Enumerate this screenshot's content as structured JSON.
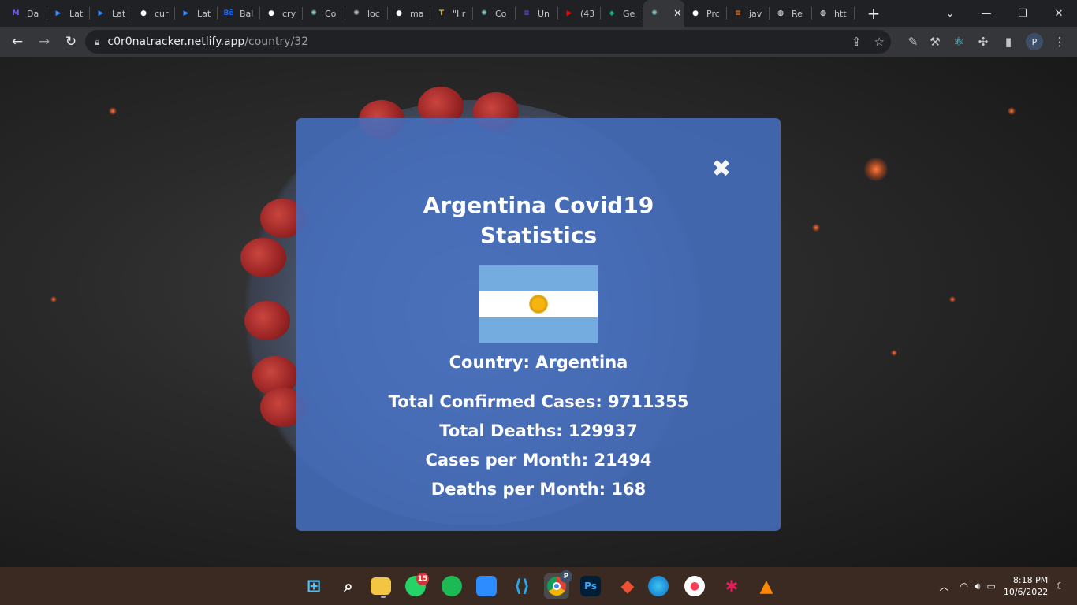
{
  "browser": {
    "tabs": [
      {
        "label": "Da",
        "icon": "m-logo-icon",
        "color": "#7b5cff"
      },
      {
        "label": "Lat",
        "icon": "zoom-icon",
        "color": "#2d8cff"
      },
      {
        "label": "Lat",
        "icon": "zoom-icon",
        "color": "#2d8cff"
      },
      {
        "label": "cur",
        "icon": "github-icon",
        "color": "#ffffff"
      },
      {
        "label": "Lat",
        "icon": "zoom-icon",
        "color": "#2d8cff"
      },
      {
        "label": "Bal",
        "icon": "behance-icon",
        "color": "#1769ff"
      },
      {
        "label": "cry",
        "icon": "github-icon",
        "color": "#ffffff"
      },
      {
        "label": "Co",
        "icon": "virus-icon",
        "color": "#7fc9c9"
      },
      {
        "label": "loc",
        "icon": "virus-icon",
        "color": "#bbbbbb"
      },
      {
        "label": "ma",
        "icon": "github-icon",
        "color": "#ffffff"
      },
      {
        "label": "\"I r",
        "icon": "t-logo-icon",
        "color": "#e8b53a"
      },
      {
        "label": "Co",
        "icon": "virus-icon",
        "color": "#7fc9c9"
      },
      {
        "label": "Un",
        "icon": "list-icon",
        "color": "#6b4fd8"
      },
      {
        "label": "(43",
        "icon": "youtube-icon",
        "color": "#ff0000"
      },
      {
        "label": "Ge",
        "icon": "diamond-icon",
        "color": "#10a37f"
      },
      {
        "label": "",
        "icon": "virus-icon",
        "color": "#7fc9c9",
        "active": true
      },
      {
        "label": "Prc",
        "icon": "github-icon",
        "color": "#ffffff"
      },
      {
        "label": "jav",
        "icon": "stackoverflow-icon",
        "color": "#f48024"
      },
      {
        "label": "Re",
        "icon": "globe-icon",
        "color": "#ffffff"
      },
      {
        "label": "htt",
        "icon": "globe-icon",
        "color": "#ffffff"
      }
    ],
    "tab_close": "✕",
    "new_tab": "+",
    "url_host": "c0r0natracker.netlify.app",
    "url_path": "/country/32",
    "profile_initial": "P"
  },
  "modal": {
    "title_line1": "Argentina Covid19",
    "title_line2": "Statistics",
    "close_symbol": "✖",
    "country_label": "Country: Argentina",
    "stats": [
      "Total Confirmed Cases: 9711355",
      "Total Deaths: 129937",
      "Cases per Month: 21494",
      "Deaths per Month: 168"
    ],
    "flag_colors": {
      "light_blue": "#74acdf",
      "white": "#ffffff",
      "sun": "#f6b40e"
    }
  },
  "taskbar": {
    "whatsapp_badge": "15",
    "chrome_profile": "P",
    "photoshop_label": "Ps",
    "time": "8:18 PM",
    "date": "10/6/2022"
  }
}
